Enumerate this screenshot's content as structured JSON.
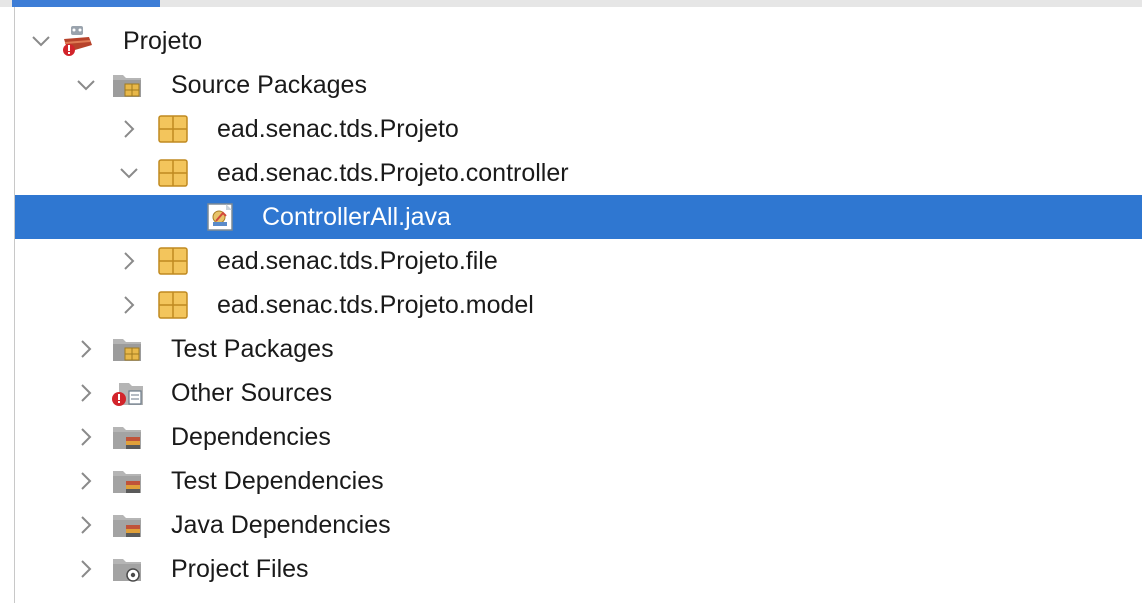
{
  "tree": {
    "nodes": [
      {
        "label": "Projeto",
        "icon": "maven-project-icon",
        "state": "expanded"
      },
      {
        "label": "Source Packages",
        "icon": "source-folder-icon",
        "state": "expanded"
      },
      {
        "label": "ead.senac.tds.Projeto",
        "icon": "package-icon",
        "state": "collapsed"
      },
      {
        "label": "ead.senac.tds.Projeto.controller",
        "icon": "package-icon",
        "state": "expanded"
      },
      {
        "label": "ControllerAll.java",
        "icon": "java-class-icon",
        "state": "leaf",
        "selected": true
      },
      {
        "label": "ead.senac.tds.Projeto.file",
        "icon": "package-icon",
        "state": "collapsed"
      },
      {
        "label": "ead.senac.tds.Projeto.model",
        "icon": "package-icon",
        "state": "collapsed"
      },
      {
        "label": "Test Packages",
        "icon": "test-folder-icon",
        "state": "collapsed"
      },
      {
        "label": "Other Sources",
        "icon": "other-sources-icon",
        "state": "collapsed"
      },
      {
        "label": "Dependencies",
        "icon": "dependencies-icon",
        "state": "collapsed"
      },
      {
        "label": "Test Dependencies",
        "icon": "dependencies-icon",
        "state": "collapsed"
      },
      {
        "label": "Java Dependencies",
        "icon": "dependencies-icon",
        "state": "collapsed"
      },
      {
        "label": "Project Files",
        "icon": "project-files-icon",
        "state": "collapsed"
      }
    ]
  },
  "colors": {
    "selection": "#2f77d1",
    "accent": "#3d7dd6",
    "package": "#e8b84a"
  }
}
